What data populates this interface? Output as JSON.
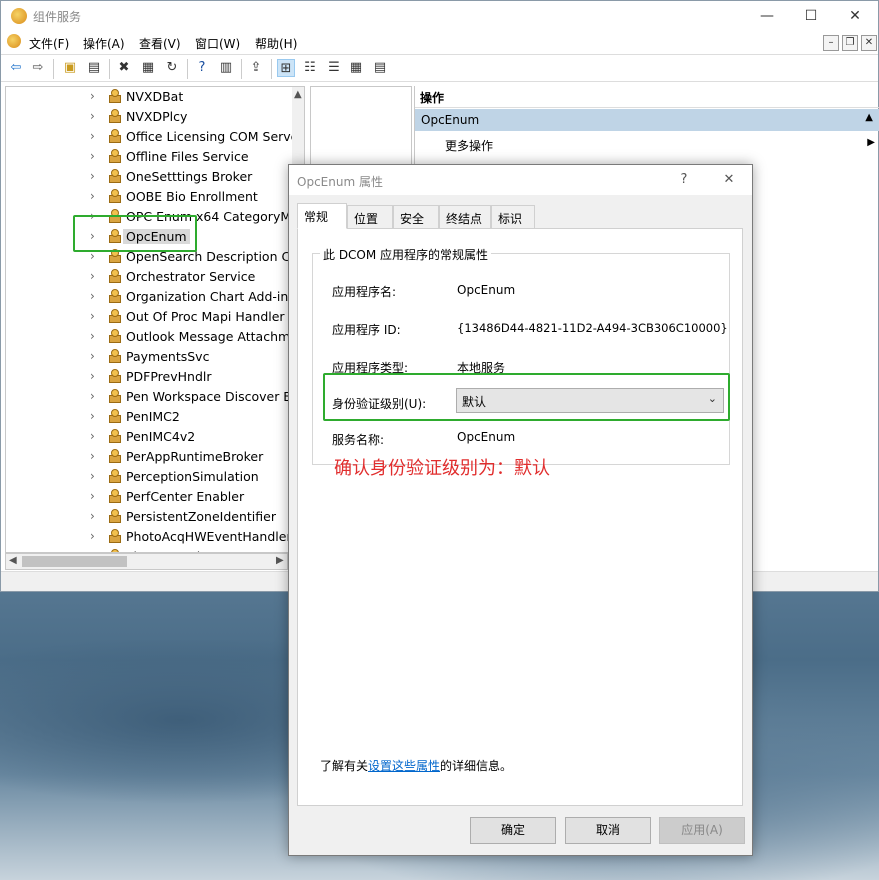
{
  "window": {
    "title": "组件服务",
    "controls": {
      "minimize": "—",
      "maximize": "☐",
      "close": "✕"
    }
  },
  "menu": [
    "文件(F)",
    "操作(A)",
    "查看(V)",
    "窗口(W)",
    "帮助(H)"
  ],
  "mdi": {
    "minimize": "–",
    "restore": "❐",
    "close": "✕"
  },
  "tree": {
    "items": [
      "NVXDBat",
      "NVXDPlcy",
      "Office Licensing COM Serve",
      "Offline Files Service",
      "OneSetttings Broker",
      "OOBE Bio Enrollment",
      "OPC Enum x64 CategoryMa",
      "OpcEnum",
      "OpenSearch Description Cre",
      "Orchestrator Service",
      "Organization Chart Add-in f",
      "Out Of Proc Mapi Handler",
      "Outlook Message Attachme",
      "PaymentsSvc",
      "PDFPrevHndlr",
      "Pen Workspace Discover Br",
      "PenIMC2",
      "PenIMC4v2",
      "PerAppRuntimeBroker",
      "PerceptionSimulation",
      "PerfCenter Enabler",
      "PersistentZoneIdentifier",
      "PhotoAcqHWEventHandler",
      "Photo Acquire"
    ],
    "selected": "OpcEnum"
  },
  "actions": {
    "header": "操作",
    "selected": "OpcEnum",
    "more": "更多操作"
  },
  "dialog": {
    "title": "OpcEnum 属性",
    "help": "?",
    "close": "✕",
    "tabs": [
      "常规",
      "位置",
      "安全",
      "终结点",
      "标识"
    ],
    "active_tab": "常规",
    "group_title": "此 DCOM 应用程序的常规属性",
    "fields": {
      "app_name_label": "应用程序名:",
      "app_name_value": "OpcEnum",
      "app_id_label": "应用程序 ID:",
      "app_id_value": "{13486D44-4821-11D2-A494-3CB306C10000}",
      "app_type_label": "应用程序类型:",
      "app_type_value": "本地服务",
      "auth_level_label": "身份验证级别(U):",
      "auth_level_value": "默认",
      "service_name_label": "服务名称:",
      "service_name_value": "OpcEnum"
    },
    "annotation": "确认身份验证级别为：默认",
    "more_info_prefix": "了解有关",
    "more_info_link": "设置这些属性",
    "more_info_suffix": "的详细信息。",
    "buttons": {
      "ok": "确定",
      "cancel": "取消",
      "apply": "应用(A)"
    }
  }
}
